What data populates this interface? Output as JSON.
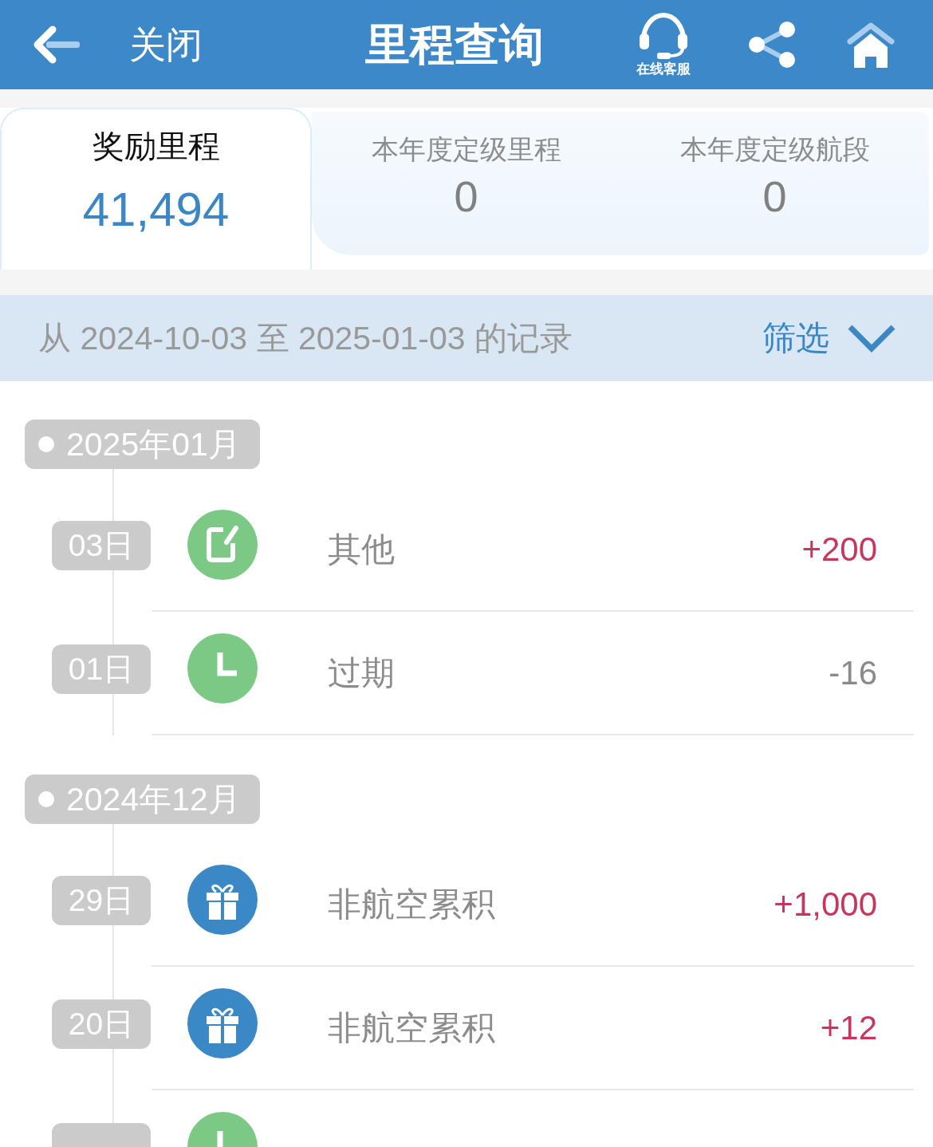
{
  "header": {
    "close_label": "关闭",
    "title": "里程查询",
    "service_label": "在线客服"
  },
  "tabs": [
    {
      "label": "奖励里程",
      "value": "41,494",
      "selected": true
    },
    {
      "label": "本年度定级里程",
      "value": "0",
      "selected": false
    },
    {
      "label": "本年度定级航段",
      "value": "0",
      "selected": false
    }
  ],
  "filter_bar": {
    "range_text": "从 2024-10-03 至 2025-01-03 的记录",
    "filter_label": "筛选"
  },
  "months": [
    {
      "label": "2025年01月",
      "entries": [
        {
          "day": "03日",
          "kind": "other",
          "label": "其他",
          "amount": "+200",
          "credit": true
        },
        {
          "day": "01日",
          "kind": "expiry",
          "label": "过期",
          "amount": "-16",
          "credit": false
        }
      ]
    },
    {
      "label": "2024年12月",
      "entries": [
        {
          "day": "29日",
          "kind": "accrual",
          "label": "非航空累积",
          "amount": "+1,000",
          "credit": true
        },
        {
          "day": "20日",
          "kind": "accrual",
          "label": "非航空累积",
          "amount": "+12",
          "credit": true
        },
        {
          "kind": "expiry"
        }
      ]
    }
  ]
}
